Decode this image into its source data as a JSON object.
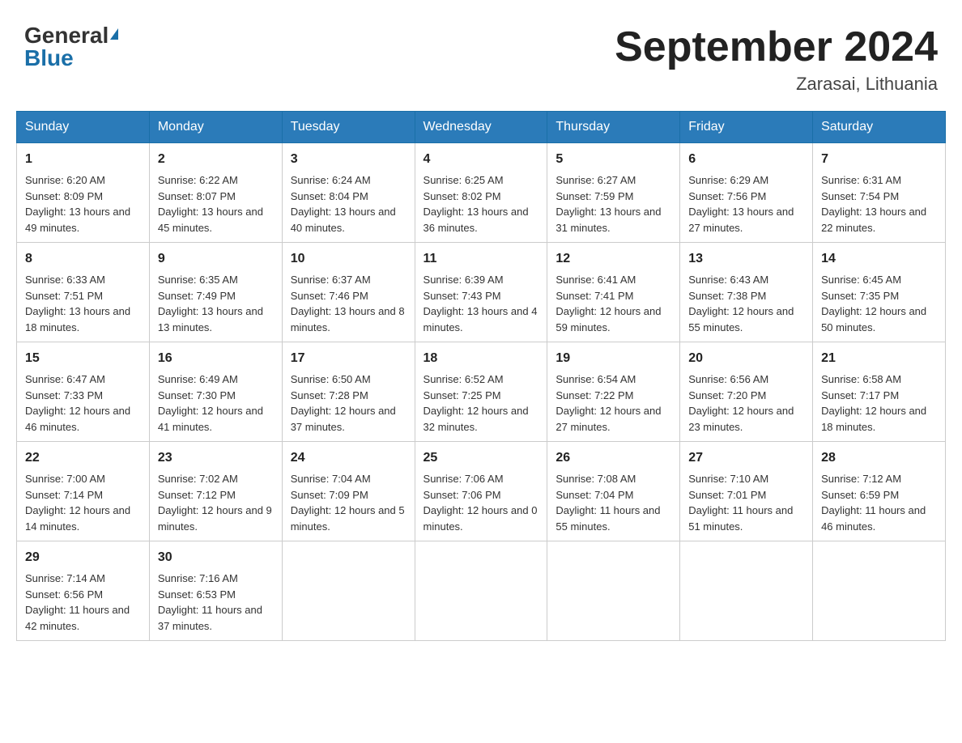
{
  "logo": {
    "general": "General",
    "blue": "Blue"
  },
  "title": "September 2024",
  "location": "Zarasai, Lithuania",
  "weekdays": [
    "Sunday",
    "Monday",
    "Tuesday",
    "Wednesday",
    "Thursday",
    "Friday",
    "Saturday"
  ],
  "weeks": [
    [
      {
        "day": "1",
        "sunrise": "6:20 AM",
        "sunset": "8:09 PM",
        "daylight": "13 hours and 49 minutes."
      },
      {
        "day": "2",
        "sunrise": "6:22 AM",
        "sunset": "8:07 PM",
        "daylight": "13 hours and 45 minutes."
      },
      {
        "day": "3",
        "sunrise": "6:24 AM",
        "sunset": "8:04 PM",
        "daylight": "13 hours and 40 minutes."
      },
      {
        "day": "4",
        "sunrise": "6:25 AM",
        "sunset": "8:02 PM",
        "daylight": "13 hours and 36 minutes."
      },
      {
        "day": "5",
        "sunrise": "6:27 AM",
        "sunset": "7:59 PM",
        "daylight": "13 hours and 31 minutes."
      },
      {
        "day": "6",
        "sunrise": "6:29 AM",
        "sunset": "7:56 PM",
        "daylight": "13 hours and 27 minutes."
      },
      {
        "day": "7",
        "sunrise": "6:31 AM",
        "sunset": "7:54 PM",
        "daylight": "13 hours and 22 minutes."
      }
    ],
    [
      {
        "day": "8",
        "sunrise": "6:33 AM",
        "sunset": "7:51 PM",
        "daylight": "13 hours and 18 minutes."
      },
      {
        "day": "9",
        "sunrise": "6:35 AM",
        "sunset": "7:49 PM",
        "daylight": "13 hours and 13 minutes."
      },
      {
        "day": "10",
        "sunrise": "6:37 AM",
        "sunset": "7:46 PM",
        "daylight": "13 hours and 8 minutes."
      },
      {
        "day": "11",
        "sunrise": "6:39 AM",
        "sunset": "7:43 PM",
        "daylight": "13 hours and 4 minutes."
      },
      {
        "day": "12",
        "sunrise": "6:41 AM",
        "sunset": "7:41 PM",
        "daylight": "12 hours and 59 minutes."
      },
      {
        "day": "13",
        "sunrise": "6:43 AM",
        "sunset": "7:38 PM",
        "daylight": "12 hours and 55 minutes."
      },
      {
        "day": "14",
        "sunrise": "6:45 AM",
        "sunset": "7:35 PM",
        "daylight": "12 hours and 50 minutes."
      }
    ],
    [
      {
        "day": "15",
        "sunrise": "6:47 AM",
        "sunset": "7:33 PM",
        "daylight": "12 hours and 46 minutes."
      },
      {
        "day": "16",
        "sunrise": "6:49 AM",
        "sunset": "7:30 PM",
        "daylight": "12 hours and 41 minutes."
      },
      {
        "day": "17",
        "sunrise": "6:50 AM",
        "sunset": "7:28 PM",
        "daylight": "12 hours and 37 minutes."
      },
      {
        "day": "18",
        "sunrise": "6:52 AM",
        "sunset": "7:25 PM",
        "daylight": "12 hours and 32 minutes."
      },
      {
        "day": "19",
        "sunrise": "6:54 AM",
        "sunset": "7:22 PM",
        "daylight": "12 hours and 27 minutes."
      },
      {
        "day": "20",
        "sunrise": "6:56 AM",
        "sunset": "7:20 PM",
        "daylight": "12 hours and 23 minutes."
      },
      {
        "day": "21",
        "sunrise": "6:58 AM",
        "sunset": "7:17 PM",
        "daylight": "12 hours and 18 minutes."
      }
    ],
    [
      {
        "day": "22",
        "sunrise": "7:00 AM",
        "sunset": "7:14 PM",
        "daylight": "12 hours and 14 minutes."
      },
      {
        "day": "23",
        "sunrise": "7:02 AM",
        "sunset": "7:12 PM",
        "daylight": "12 hours and 9 minutes."
      },
      {
        "day": "24",
        "sunrise": "7:04 AM",
        "sunset": "7:09 PM",
        "daylight": "12 hours and 5 minutes."
      },
      {
        "day": "25",
        "sunrise": "7:06 AM",
        "sunset": "7:06 PM",
        "daylight": "12 hours and 0 minutes."
      },
      {
        "day": "26",
        "sunrise": "7:08 AM",
        "sunset": "7:04 PM",
        "daylight": "11 hours and 55 minutes."
      },
      {
        "day": "27",
        "sunrise": "7:10 AM",
        "sunset": "7:01 PM",
        "daylight": "11 hours and 51 minutes."
      },
      {
        "day": "28",
        "sunrise": "7:12 AM",
        "sunset": "6:59 PM",
        "daylight": "11 hours and 46 minutes."
      }
    ],
    [
      {
        "day": "29",
        "sunrise": "7:14 AM",
        "sunset": "6:56 PM",
        "daylight": "11 hours and 42 minutes."
      },
      {
        "day": "30",
        "sunrise": "7:16 AM",
        "sunset": "6:53 PM",
        "daylight": "11 hours and 37 minutes."
      },
      null,
      null,
      null,
      null,
      null
    ]
  ]
}
